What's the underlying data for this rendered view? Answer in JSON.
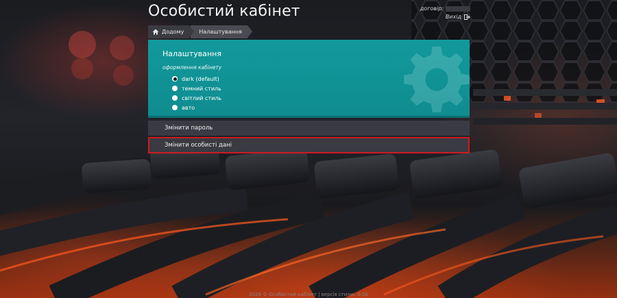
{
  "header": {
    "title": "Особистий кабінет",
    "contract_label": "договір:",
    "logout_label": "Вихід"
  },
  "breadcrumb": {
    "items": [
      {
        "label": "Додому",
        "icon": "home-icon"
      },
      {
        "label": "Налаштування"
      }
    ]
  },
  "settings": {
    "title": "Налаштування",
    "theme_label": "оформлення кабінету",
    "theme_options": [
      {
        "label": "dark (default)",
        "checked": true
      },
      {
        "label": "темний стиль",
        "checked": false
      },
      {
        "label": "світлий стиль",
        "checked": false
      },
      {
        "label": "авто",
        "checked": false
      }
    ],
    "watermark_icon": "gear-icon"
  },
  "actions": {
    "change_password": "Змінити пароль",
    "change_personal": "Змінити особисті дані"
  },
  "footer": {
    "text": "2024 © Особистий кабінет | версія стилю: 0.5b"
  },
  "colors": {
    "panel": "#12999b",
    "row_bg": "#3a3a42",
    "highlight_border": "#d01a1f"
  }
}
